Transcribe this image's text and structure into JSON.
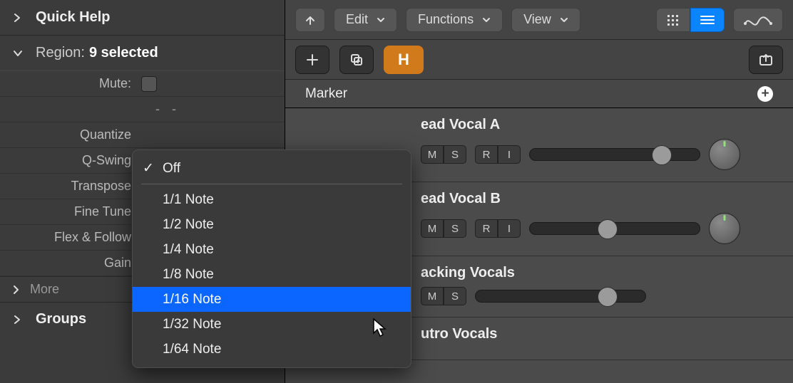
{
  "inspector": {
    "quick_help": "Quick Help",
    "region_label": "Region:",
    "region_value": "9 selected",
    "params": {
      "mute": "Mute:",
      "loop_dash": "-  -",
      "quantize": "Quantize",
      "qswing": "Q-Swing",
      "transpose": "Transpose",
      "finetune": "Fine Tune",
      "flex": "Flex & Follow",
      "gain": "Gain"
    },
    "more": "More",
    "groups": "Groups"
  },
  "toolbar": {
    "edit": "Edit",
    "functions": "Functions",
    "view": "View"
  },
  "subbar": {
    "h": "H"
  },
  "marker": {
    "label": "Marker"
  },
  "tracks": [
    {
      "name": "ead Vocal A",
      "ms": [
        "M",
        "S"
      ],
      "ri": [
        "R",
        "I"
      ],
      "slider": 0.78,
      "knob": true
    },
    {
      "name": "ead Vocal B",
      "ms": [
        "M",
        "S"
      ],
      "ri": [
        "R",
        "I"
      ],
      "slider": 0.46,
      "knob": true
    },
    {
      "name": "acking Vocals",
      "ms": [
        "M",
        "S"
      ],
      "ri": null,
      "slider": 0.78,
      "knob": false
    },
    {
      "name": "utro Vocals",
      "ms": null,
      "ri": null,
      "slider": null,
      "knob": false
    }
  ],
  "popup": {
    "off": "Off",
    "items": [
      "1/1 Note",
      "1/2 Note",
      "1/4 Note",
      "1/8 Note",
      "1/16 Note",
      "1/32 Note",
      "1/64 Note"
    ],
    "selected_index": 4
  }
}
